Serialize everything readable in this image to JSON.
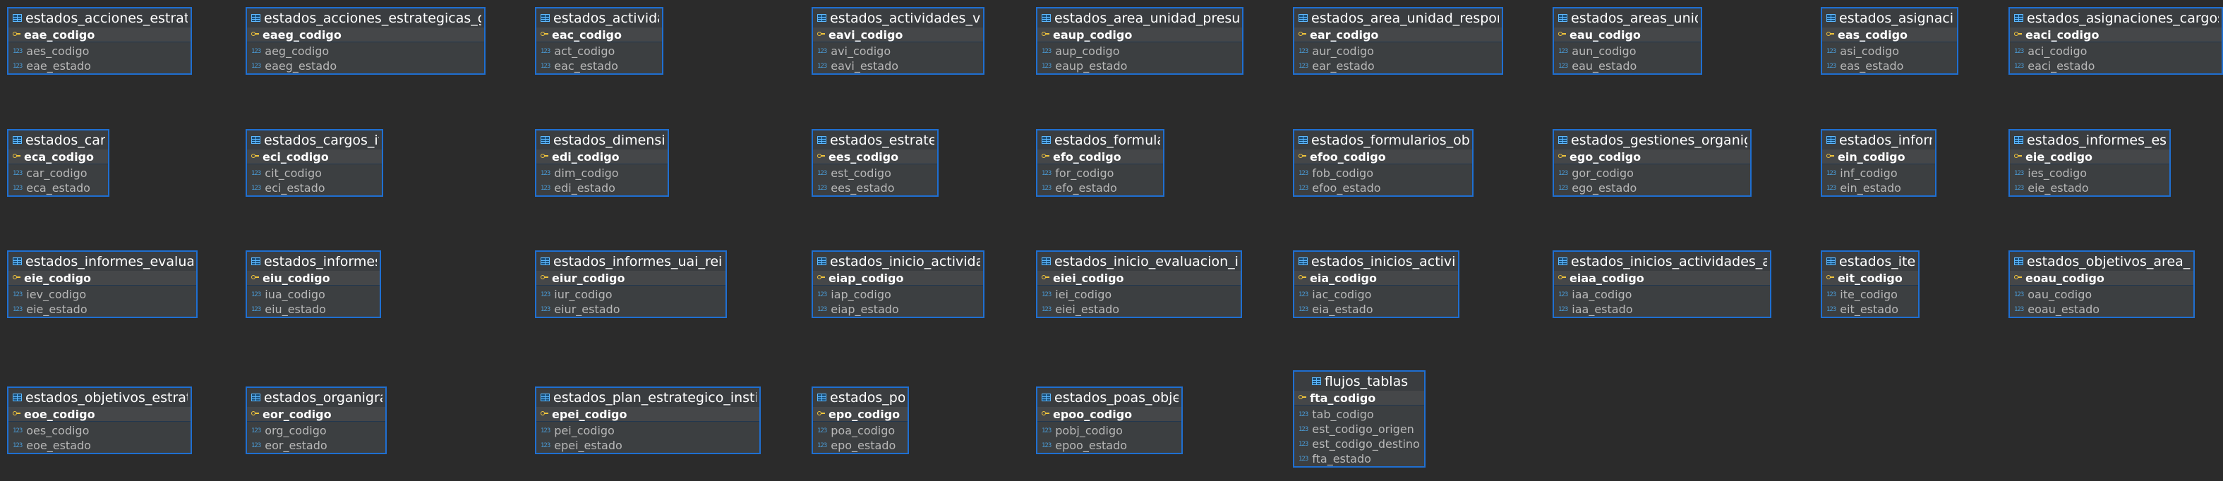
{
  "diagram": {
    "column_type_icon": "123",
    "entities": [
      {
        "name": "estados_acciones_estrategicas",
        "pk": "eae_codigo",
        "attributes": [
          "aes_codigo",
          "eae_estado"
        ]
      },
      {
        "name": "estados_acciones_estrategicas_gestion",
        "pk": "eaeg_codigo",
        "attributes": [
          "aeg_codigo",
          "eaeg_estado"
        ]
      },
      {
        "name": "estados_actividades",
        "pk": "eac_codigo",
        "attributes": [
          "act_codigo",
          "eac_estado"
        ]
      },
      {
        "name": "estados_actividades_viaticos",
        "pk": "eavi_codigo",
        "attributes": [
          "avi_codigo",
          "eavi_estado"
        ]
      },
      {
        "name": "estados_area_unidad_presupuestaria",
        "pk": "eaup_codigo",
        "attributes": [
          "aup_codigo",
          "eaup_estado"
        ]
      },
      {
        "name": "estados_area_unidad_responsable",
        "pk": "ear_codigo",
        "attributes": [
          "aur_codigo",
          "ear_estado"
        ]
      },
      {
        "name": "estados_areas_unidades",
        "pk": "eau_codigo",
        "attributes": [
          "aun_codigo",
          "eau_estado"
        ]
      },
      {
        "name": "estados_asignaciones",
        "pk": "eas_codigo",
        "attributes": [
          "asi_codigo",
          "eas_estado"
        ]
      },
      {
        "name": "estados_asignaciones_cargos_items",
        "pk": "eaci_codigo",
        "attributes": [
          "aci_codigo",
          "eaci_estado"
        ]
      },
      {
        "name": "estados_cargos",
        "pk": "eca_codigo",
        "attributes": [
          "car_codigo",
          "eca_estado"
        ]
      },
      {
        "name": "estados_cargos_items",
        "pk": "eci_codigo",
        "attributes": [
          "cit_codigo",
          "eci_estado"
        ]
      },
      {
        "name": "estados_dimensiones",
        "pk": "edi_codigo",
        "attributes": [
          "dim_codigo",
          "edi_estado"
        ]
      },
      {
        "name": "estados_estrategias",
        "pk": "ees_codigo",
        "attributes": [
          "est_codigo",
          "ees_estado"
        ]
      },
      {
        "name": "estados_formularios",
        "pk": "efo_codigo",
        "attributes": [
          "for_codigo",
          "efo_estado"
        ]
      },
      {
        "name": "estados_formularios_objetivos",
        "pk": "efoo_codigo",
        "attributes": [
          "fob_codigo",
          "efoo_estado"
        ]
      },
      {
        "name": "estados_gestiones_organigramas",
        "pk": "ego_codigo",
        "attributes": [
          "gor_codigo",
          "ego_estado"
        ]
      },
      {
        "name": "estados_informes",
        "pk": "ein_codigo",
        "attributes": [
          "inf_codigo",
          "ein_estado"
        ]
      },
      {
        "name": "estados_informes_estados",
        "pk": "eie_codigo",
        "attributes": [
          "ies_codigo",
          "eie_estado"
        ]
      },
      {
        "name": "estados_informes_evaluaciones",
        "pk": "eie_codigo",
        "attributes": [
          "iev_codigo",
          "eie_estado"
        ]
      },
      {
        "name": "estados_informes_uai",
        "pk": "eiu_codigo",
        "attributes": [
          "iua_codigo",
          "eiu_estado"
        ]
      },
      {
        "name": "estados_informes_uai_reingresos",
        "pk": "eiur_codigo",
        "attributes": [
          "iur_codigo",
          "eiur_estado"
        ]
      },
      {
        "name": "estados_inicio_actividad_poa",
        "pk": "eiap_codigo",
        "attributes": [
          "iap_codigo",
          "eiap_estado"
        ]
      },
      {
        "name": "estados_inicio_evaluacion_informe",
        "pk": "eiei_codigo",
        "attributes": [
          "iei_codigo",
          "eiei_estado"
        ]
      },
      {
        "name": "estados_inicios_actividades",
        "pk": "eia_codigo",
        "attributes": [
          "iac_codigo",
          "eia_estado"
        ]
      },
      {
        "name": "estados_inicios_actividades_adicionales",
        "pk": "eiaa_codigo",
        "attributes": [
          "iaa_codigo",
          "iaa_estado"
        ]
      },
      {
        "name": "estados_items",
        "pk": "eit_codigo",
        "attributes": [
          "ite_codigo",
          "eit_estado"
        ]
      },
      {
        "name": "estados_objetivos_area_unidad",
        "pk": "eoau_codigo",
        "attributes": [
          "oau_codigo",
          "eoau_estado"
        ]
      },
      {
        "name": "estados_objetivos_estrategicos",
        "pk": "eoe_codigo",
        "attributes": [
          "oes_codigo",
          "eoe_estado"
        ]
      },
      {
        "name": "estados_organigramas",
        "pk": "eor_codigo",
        "attributes": [
          "org_codigo",
          "eor_estado"
        ]
      },
      {
        "name": "estados_plan_estrategico_institucional",
        "pk": "epei_codigo",
        "attributes": [
          "pei_codigo",
          "epei_estado"
        ]
      },
      {
        "name": "estados_poas",
        "pk": "epo_codigo",
        "attributes": [
          "poa_codigo",
          "epo_estado"
        ]
      },
      {
        "name": "estados_poas_objetivos",
        "pk": "epoo_codigo",
        "attributes": [
          "pobj_codigo",
          "epoo_estado"
        ]
      },
      {
        "name": "flujos_tablas",
        "pk": "fta_codigo",
        "attributes": [
          "tab_codigo",
          "est_codigo_origen",
          "est_codigo_destino",
          "fta_estado"
        ]
      }
    ]
  }
}
